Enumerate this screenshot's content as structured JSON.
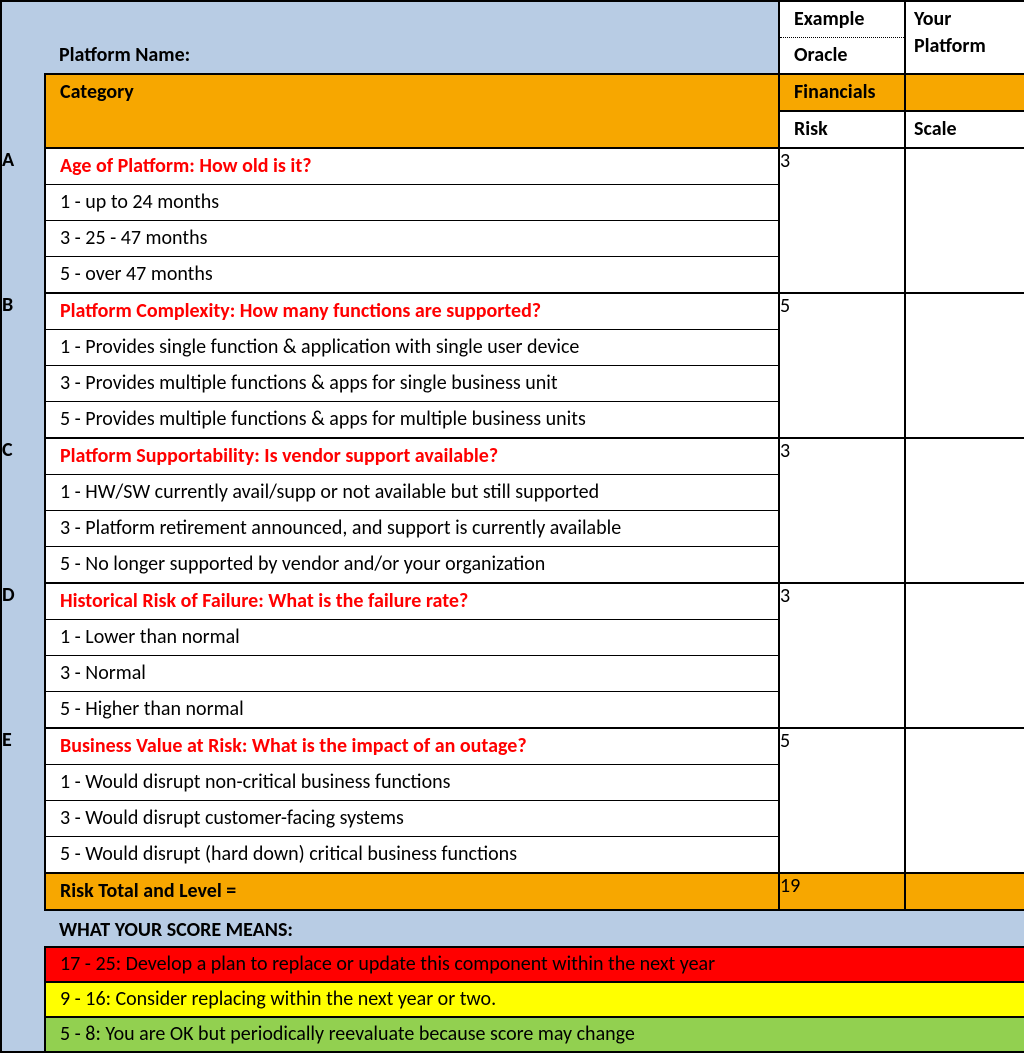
{
  "header": {
    "platform_name_label": "Platform Name:",
    "example_label": "Example",
    "oracle": "Oracle",
    "your_platform": "Your Platform",
    "category_label": "Category",
    "financials": "Financials",
    "risk_label": "Risk",
    "scale_label": "Scale"
  },
  "groups": [
    {
      "letter": "A",
      "title": "Age of Platform: How old is it?",
      "options": [
        "1 - up to 24 months",
        "3 - 25 - 47 months",
        "5 - over 47 months"
      ],
      "risk": "3"
    },
    {
      "letter": "B",
      "title": "Platform Complexity: How many functions are supported?",
      "options": [
        "1 - Provides single function & application with single user device",
        "3 - Provides multiple functions & apps for single business unit",
        "5 - Provides multiple functions & apps for multiple business units"
      ],
      "risk": "5"
    },
    {
      "letter": "C",
      "title": "Platform Supportability: Is vendor support available?",
      "options": [
        "1 - HW/SW currently avail/supp or not available but still supported",
        "3 - Platform retirement announced, and support is currently available",
        "5 - No longer supported by vendor and/or your organization"
      ],
      "risk": "3"
    },
    {
      "letter": "D",
      "title": "Historical Risk of Failure: What is the failure rate?",
      "options": [
        "1 - Lower than normal",
        "3 - Normal",
        "5 - Higher than normal"
      ],
      "risk": "3"
    },
    {
      "letter": "E",
      "title": "Business Value at Risk: What is the impact of an outage?",
      "options": [
        "1 - Would disrupt non-critical business functions",
        "3 - Would disrupt customer-facing systems",
        "5 - Would disrupt (hard down) critical business functions"
      ],
      "risk": "5"
    }
  ],
  "totals": {
    "label": "Risk Total and Level =",
    "value": "19"
  },
  "meaning": {
    "heading": "WHAT YOUR SCORE MEANS:",
    "red": "17 - 25: Develop a plan to replace or update this component within the next year",
    "yellow": "9 - 16: Consider replacing within the next year or two.",
    "green": "5 - 8: You are OK but periodically reevaluate because score may change"
  }
}
